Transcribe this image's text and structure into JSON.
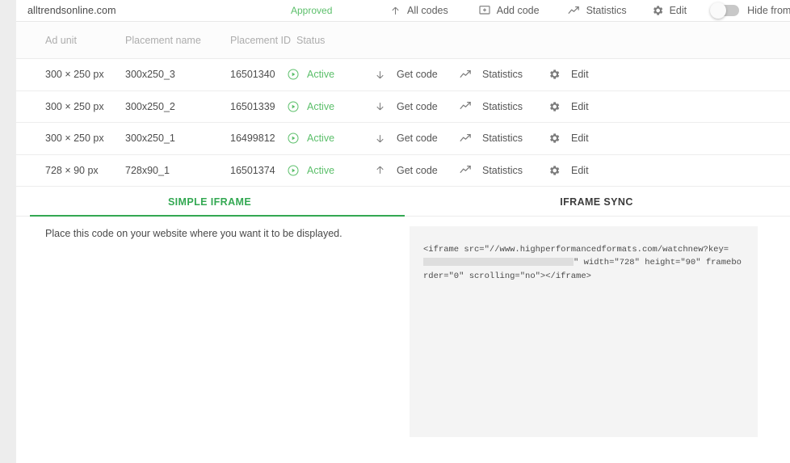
{
  "site": {
    "domain": "alltrendsonline.com",
    "status": "Approved"
  },
  "toolbar": {
    "all_codes": "All codes",
    "add_code": "Add code",
    "statistics": "Statistics",
    "edit": "Edit",
    "hide_from_statistics": "Hide from statistics",
    "hide_toggle_state": "off"
  },
  "table": {
    "headers": {
      "ad_unit": "Ad unit",
      "placement_name": "Placement name",
      "placement_id": "Placement ID",
      "status": "Status"
    },
    "rows": [
      {
        "ad_unit": "300 × 250 px",
        "placement_name": "300x250_3",
        "placement_id": "16501340",
        "status": "Active",
        "get_code": "Get code",
        "get_code_arrow": "arrow-down",
        "statistics": "Statistics",
        "edit": "Edit"
      },
      {
        "ad_unit": "300 × 250 px",
        "placement_name": "300x250_2",
        "placement_id": "16501339",
        "status": "Active",
        "get_code": "Get code",
        "get_code_arrow": "arrow-down",
        "statistics": "Statistics",
        "edit": "Edit"
      },
      {
        "ad_unit": "300 × 250 px",
        "placement_name": "300x250_1",
        "placement_id": "16499812",
        "status": "Active",
        "get_code": "Get code",
        "get_code_arrow": "arrow-down",
        "statistics": "Statistics",
        "edit": "Edit"
      },
      {
        "ad_unit": "728 × 90 px",
        "placement_name": "728x90_1",
        "placement_id": "16501374",
        "status": "Active",
        "get_code": "Get code",
        "get_code_arrow": "arrow-up",
        "statistics": "Statistics",
        "edit": "Edit"
      }
    ]
  },
  "tabs": [
    {
      "label": "SIMPLE IFRAME",
      "active": true
    },
    {
      "label": "IFRAME SYNC",
      "active": false
    }
  ],
  "code_panel": {
    "hint": "Place this code on your website where you want it to be displayed.",
    "code_part1": "<iframe src=\"//www.highperformancedformats.com/watchnew?key=",
    "code_part2": "\" width=\"728\" height=\"90\" frameborder=\"0\" scrolling=\"no\"></iframe>",
    "redacted_label": "redacted-key"
  },
  "colors": {
    "accent_green": "#33a852",
    "status_green": "#5bbf6a",
    "text_grey": "#4a4a4a",
    "muted_grey": "#adadad",
    "panel_bg": "#f4f4f4"
  }
}
